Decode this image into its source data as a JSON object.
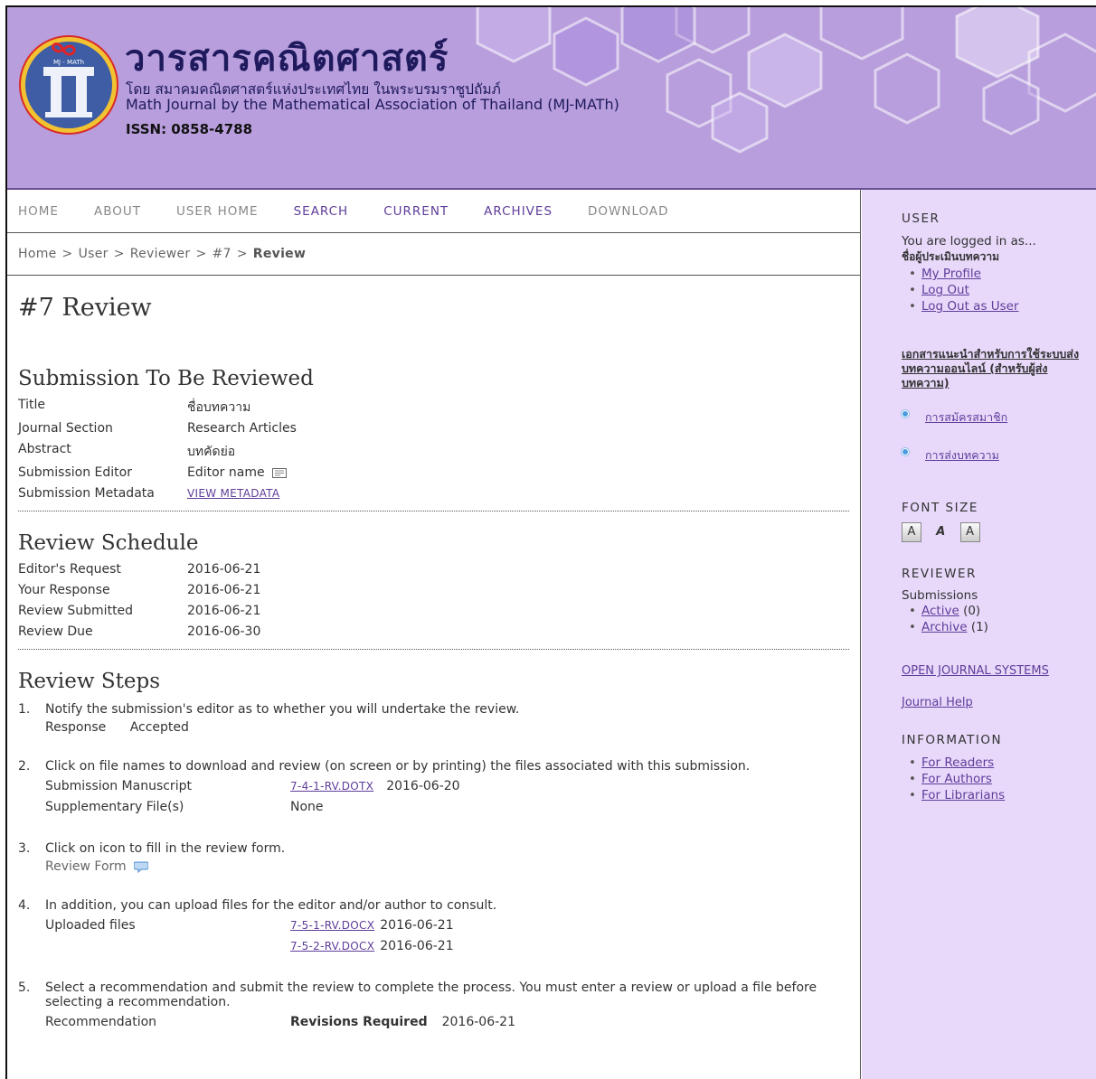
{
  "header": {
    "title_th": "วารสารคณิตศาสตร์",
    "subtitle_th": "โดย สมาคมคณิตศาสตร์แห่งประเทศไทย ในพระบรมราชูปถัมภ์",
    "subtitle_en": "Math Journal by the Mathematical Association of Thailand (MJ-MATh)",
    "issn": "ISSN: 0858-4788",
    "logo_text": "MJ - MATh"
  },
  "nav": {
    "items": [
      "HOME",
      "ABOUT",
      "USER HOME",
      "SEARCH",
      "CURRENT",
      "ARCHIVES",
      "DOWNLOAD"
    ]
  },
  "breadcrumb": {
    "items": [
      "Home",
      "User",
      "Reviewer",
      "#7"
    ],
    "current": "Review",
    "separator": ">"
  },
  "page_title": "#7 Review",
  "submission": {
    "heading": "Submission To Be Reviewed",
    "rows": [
      {
        "label": "Title",
        "value": "ชื่อบทความ"
      },
      {
        "label": "Journal Section",
        "value": "Research Articles"
      },
      {
        "label": "Abstract",
        "value": "บทคัดย่อ"
      },
      {
        "label": "Submission Editor",
        "value": "Editor name"
      },
      {
        "label": "Submission Metadata",
        "value": "VIEW METADATA"
      }
    ]
  },
  "schedule": {
    "heading": "Review Schedule",
    "rows": [
      {
        "label": "Editor's Request",
        "value": "2016-06-21"
      },
      {
        "label": "Your Response",
        "value": "2016-06-21"
      },
      {
        "label": "Review Submitted",
        "value": "2016-06-21"
      },
      {
        "label": "Review Due",
        "value": "2016-06-30"
      }
    ]
  },
  "steps": {
    "heading": "Review Steps",
    "s1": {
      "num": "1.",
      "text": "Notify the submission's editor as to whether you will undertake the review.",
      "label": "Response",
      "value": "Accepted"
    },
    "s2": {
      "num": "2.",
      "text": "Click on file names to download and review (on screen or by printing) the files associated with this submission.",
      "manuscript_label": "Submission Manuscript",
      "manuscript_file": "7-4-1-RV.DOTX",
      "manuscript_date": "2016-06-20",
      "supp_label": "Supplementary File(s)",
      "supp_value": "None"
    },
    "s3": {
      "num": "3.",
      "text": "Click on icon to fill in the review form.",
      "label": "Review Form"
    },
    "s4": {
      "num": "4.",
      "text": "In addition, you can upload files for the editor and/or author to consult.",
      "label": "Uploaded files",
      "file1": "7-5-1-RV.DOCX",
      "date1": "2016-06-21",
      "file2": "7-5-2-RV.DOCX",
      "date2": "2016-06-21"
    },
    "s5": {
      "num": "5.",
      "text": "Select a recommendation and submit the review to complete the process. You must enter a review or upload a file before selecting a recommendation.",
      "label": "Recommendation",
      "value": "Revisions Required",
      "date": "2016-06-21"
    }
  },
  "sidebar": {
    "user_heading": "USER",
    "logged_in": "You are logged in as...",
    "username": "ชื่อผู้ประเมินบทความ",
    "user_links": [
      "My Profile",
      "Log Out",
      "Log Out as User"
    ],
    "guide_link": "เอกสารแนะนำสำหรับการใช้ระบบส่งบทความออนไลน์ (สำหรับผู้ส่งบทความ)",
    "guide_items": [
      "การสมัครสมาชิก",
      "การส่งบทความ"
    ],
    "font_heading": "FONT SIZE",
    "reviewer_heading": "REVIEWER",
    "submissions_label": "Submissions",
    "active_label": "Active",
    "active_count": "(0)",
    "archive_label": "Archive",
    "archive_count": "(1)",
    "ojs_link": "OPEN JOURNAL SYSTEMS",
    "help_link": "Journal Help",
    "info_heading": "INFORMATION",
    "info_links": [
      "For Readers",
      "For Authors",
      "For Librarians"
    ]
  },
  "colors": {
    "header_bg": "#b89edc",
    "sidebar_bg": "#e8d9fb",
    "link": "#5f3d9a",
    "title": "#1f1a5e"
  }
}
